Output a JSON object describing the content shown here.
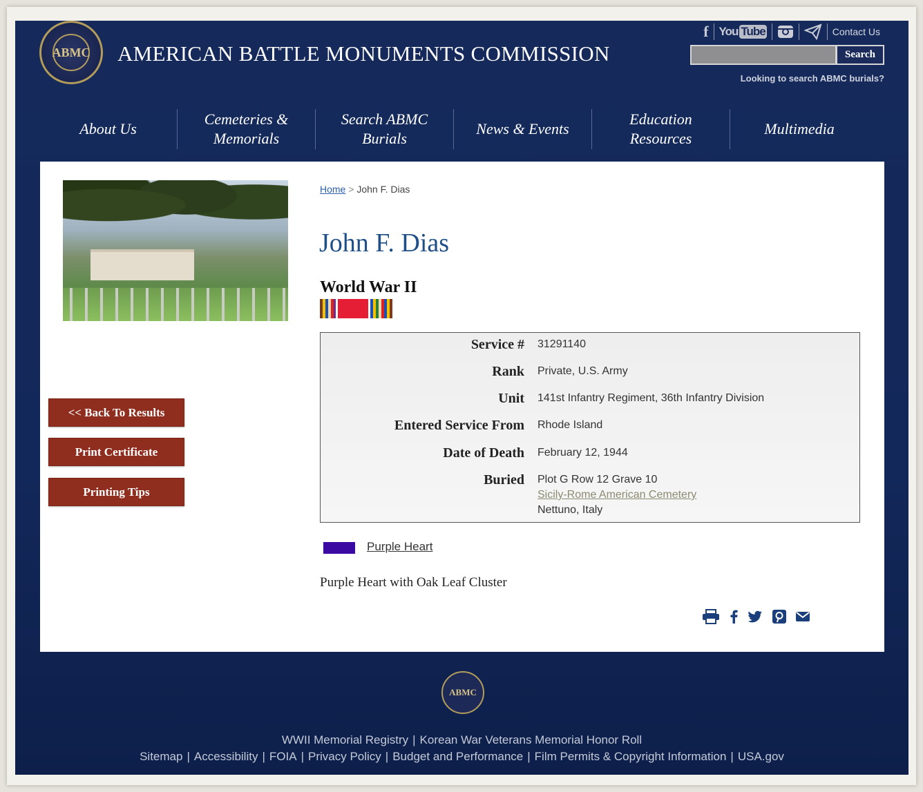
{
  "header": {
    "title": "AMERICAN BATTLE MONUMENTS COMMISSION",
    "seal_text": "ABMC",
    "social": {
      "facebook": "f",
      "youtube_a": "You",
      "youtube_b": "Tube",
      "contact": "Contact Us"
    },
    "search_button": "Search",
    "search_placeholder": "",
    "search_hint": "Looking to search ABMC burials?"
  },
  "nav": [
    "About Us",
    "Cemeteries &\nMemorials",
    "Search ABMC\nBurials",
    "News & Events",
    "Education\nResources",
    "Multimedia"
  ],
  "sidebar": {
    "buttons": [
      "<< Back To Results",
      "Print Certificate",
      "Printing Tips"
    ]
  },
  "breadcrumb": {
    "home": "Home",
    "separator": ">",
    "current": "John F. Dias"
  },
  "person": {
    "name": "John F. Dias",
    "war": "World War II",
    "details": [
      {
        "label": "Service #",
        "value": "31291140"
      },
      {
        "label": "Rank",
        "value": "Private, U.S. Army"
      },
      {
        "label": "Unit",
        "value": "141st Infantry Regiment, 36th Infantry Division"
      },
      {
        "label": "Entered Service From",
        "value": "Rhode Island"
      },
      {
        "label": "Date of Death",
        "value": "February 12, 1944"
      },
      {
        "label": "Buried",
        "value": "Plot G Row 12 Grave 10",
        "cemetery": "Sicily-Rome American Cemetery",
        "location": "Nettuno, Italy"
      }
    ],
    "award_link": "Purple Heart",
    "award_text": "Purple Heart with Oak Leaf Cluster"
  },
  "colors": {
    "brand_navy": "#13285a",
    "button_red": "#8f2e1f",
    "name_blue": "#1f4f86",
    "purple_heart": "#3a0aa3"
  },
  "footer": {
    "line1": [
      "WWII Memorial Registry",
      "Korean War Veterans Memorial Honor Roll"
    ],
    "line2": [
      "Sitemap",
      "Accessibility",
      "FOIA",
      "Privacy Policy",
      "Budget and Performance",
      "Film Permits & Copyright Information",
      "USA.gov"
    ]
  }
}
